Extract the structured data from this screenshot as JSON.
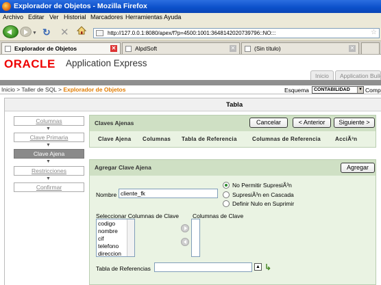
{
  "browser": {
    "window_title": "Explorador de Objetos - Mozilla Firefox",
    "menu": [
      "Archivo",
      "Editar",
      "Ver",
      "Historial",
      "Marcadores",
      "Herramientas",
      "Ayuda"
    ],
    "url": "http://127.0.0.1:8080/apex/f?p=4500:1001:3648142020739796::NO:::",
    "tabs": [
      {
        "label": "Explorador de Objetos",
        "active": true
      },
      {
        "label": "AlpdSoft",
        "active": false
      },
      {
        "label": "(Sin título)",
        "active": false
      }
    ]
  },
  "app": {
    "logo": "ORACLE",
    "title": "Application Express",
    "top_tabs": [
      "Inicio",
      "Application Build"
    ],
    "breadcrumb": {
      "items": [
        "Inicio",
        "Taller de SQL"
      ],
      "current": "Explorador de Objetos",
      "separator": ">"
    },
    "schema_label": "Esquema",
    "schema_value": "CONTABILIDAD",
    "comp_label": "Comp"
  },
  "panel": {
    "title": "Tabla"
  },
  "wizard_steps": [
    {
      "label": "Columnas",
      "active": false
    },
    {
      "label": "Clave Primaria",
      "active": false
    },
    {
      "label": "Clave Ajena",
      "active": true
    },
    {
      "label": "Restricciones",
      "active": false
    },
    {
      "label": "Confirmar",
      "active": false
    }
  ],
  "claves_ajenas": {
    "title": "Claves Ajenas",
    "cancel_label": "Cancelar",
    "prev_label": "< Anterior",
    "next_label": "Siguiente >",
    "columns": [
      "Clave Ajena",
      "Columnas",
      "Tabla de Referencia",
      "Columnas de Referencia",
      "AcciÃ³n"
    ]
  },
  "agregar": {
    "title": "Agregar Clave Ajena",
    "add_label": "Agregar",
    "nombre_label": "Nombre",
    "nombre_value": "cliente_fk",
    "on_delete_options": [
      {
        "label": "No Permitir SupresiÃ³n",
        "checked": true
      },
      {
        "label": "SupresiÃ³n en Cascada",
        "checked": false
      },
      {
        "label": "Definir Nulo en Suprimir",
        "checked": false
      }
    ],
    "select_columns_label": "Seleccionar Columnas de Clave",
    "key_columns_label": "Columnas de Clave",
    "available_columns": [
      "codigo",
      "nombre",
      "cif",
      "telefono",
      "direccion"
    ],
    "ref_table_label": "Tabla de Referencias",
    "ref_table_value": ""
  }
}
